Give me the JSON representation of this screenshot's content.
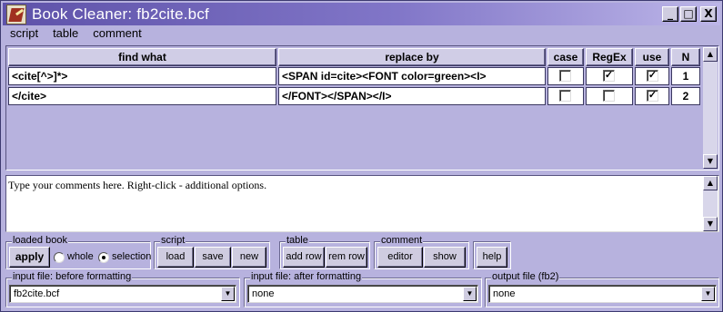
{
  "window": {
    "title": "Book Cleaner: fb2cite.bcf",
    "minimize": "_",
    "maximize": "□",
    "close": "X"
  },
  "menu": [
    "script",
    "table",
    "comment"
  ],
  "table": {
    "headers": [
      "find what",
      "replace by",
      "case",
      "RegEx",
      "use",
      "N"
    ],
    "rows": [
      {
        "find": "<cite[^>]*>",
        "replace": "<SPAN id=cite><FONT color=green><I>",
        "case": false,
        "regex": true,
        "use": true,
        "n": "1"
      },
      {
        "find": "</cite>",
        "replace": "</FONT></SPAN></I>",
        "case": false,
        "regex": false,
        "use": true,
        "n": "2"
      }
    ]
  },
  "comment": {
    "text": "Type your comments here. Right-click - additional options."
  },
  "groups": {
    "loaded_book": {
      "label": "loaded book",
      "apply": "apply",
      "whole": "whole",
      "selection": "selection",
      "selected": "selection"
    },
    "script": {
      "label": "script",
      "load": "load",
      "save": "save",
      "new": "new"
    },
    "table": {
      "label": "table",
      "add_row": "add row",
      "rem_row": "rem row"
    },
    "comment": {
      "label": "comment",
      "editor": "editor",
      "show": "show"
    },
    "help": "help"
  },
  "files": {
    "input_before": {
      "label": "input file: before formatting",
      "value": "fb2cite.bcf"
    },
    "input_after": {
      "label": "input file: after formatting",
      "value": "none"
    },
    "output": {
      "label": "output file (fb2)",
      "value": "none"
    }
  },
  "icons": {
    "app": "book-cleaner-icon",
    "dropdown": "chevron-down-icon",
    "scroll_up": "arrow-up-icon",
    "scroll_down": "arrow-down-icon"
  }
}
